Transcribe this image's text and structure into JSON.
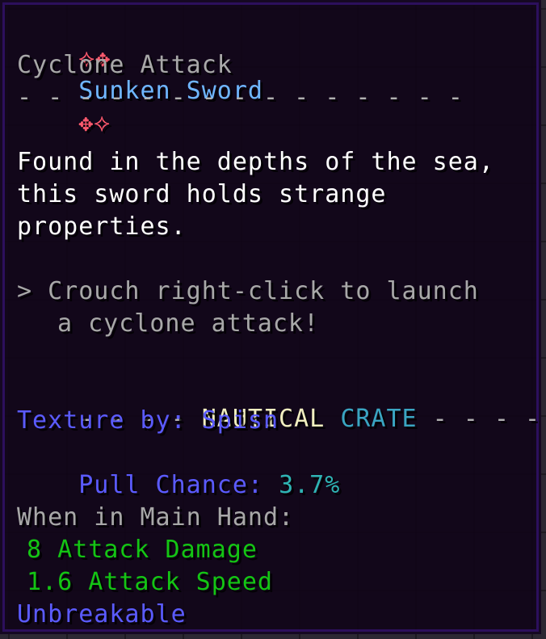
{
  "tooltip": {
    "title_deco_left": "⟡✥",
    "title": "Sunken Sword",
    "title_deco_right": "✥⟡",
    "subtitle": "Cyclone Attack",
    "separator": "- - - - - - - - - - - - - - -",
    "description": [
      "Found in the depths of the sea,",
      "this sword holds strange",
      "properties."
    ],
    "ability_line1": "> Crouch right-click to launch",
    "ability_line2": "a cyclone attack!",
    "crate_dashes_left": "- - - - ",
    "crate_word1": "NAUTICAL",
    "crate_word2": "CRATE",
    "crate_dashes_right": " - - - -",
    "texture_label": "Texture by: Spisn",
    "pull_label": "Pull Chance: ",
    "pull_value": "3.7%",
    "main_hand": "When in Main Hand:",
    "attack_damage": "8 Attack Damage",
    "attack_speed": "1.6 Attack Speed",
    "unbreakable": "Unbreakable"
  },
  "colors": {
    "title": "#6fb6ff",
    "deco": "#ff5a6e",
    "nautical": "#f1efc0",
    "crate": "#3aa5c2",
    "blue_text": "#5b5bff",
    "aqua_value": "#2fb4b4",
    "green_stats": "#14c514"
  }
}
